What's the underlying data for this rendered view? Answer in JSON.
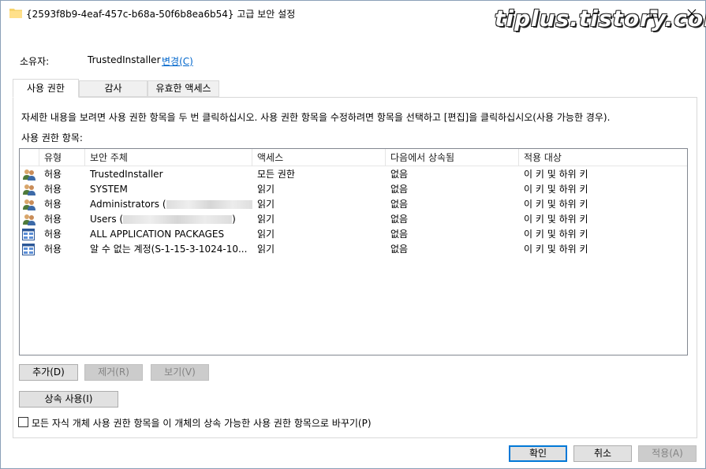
{
  "window": {
    "title": "{2593f8b9-4eaf-457c-b68a-50f6b8ea6b54} 고급 보안 설정",
    "watermark": "tiplus.tistory.com"
  },
  "owner": {
    "label": "소유자:",
    "value": "TrustedInstaller",
    "change_link": "변경(C)"
  },
  "tabs": [
    {
      "label": "사용 권한",
      "active": true
    },
    {
      "label": "감사",
      "active": false
    },
    {
      "label": "유효한 액세스",
      "active": false
    }
  ],
  "panel": {
    "description": "자세한 내용을 보려면 사용 권한 항목을 두 번 클릭하십시오. 사용 권한 항목을 수정하려면 항목을 선택하고 [편집]을 클릭하십시오(사용 가능한 경우).",
    "entries_label": "사용 권한 항목:"
  },
  "columns": {
    "type": "유형",
    "principal": "보안 주체",
    "access": "액세스",
    "inherited_from": "다음에서 상속됨",
    "applies_to": "적용 대상"
  },
  "rows": [
    {
      "icon": "users-icon",
      "type": "허용",
      "principal": "TrustedInstaller",
      "access": "모든 권한",
      "inherited_from": "없음",
      "applies_to": "이 키 및 하위 키"
    },
    {
      "icon": "users-icon",
      "type": "허용",
      "principal": "SYSTEM",
      "access": "읽기",
      "inherited_from": "없음",
      "applies_to": "이 키 및 하위 키"
    },
    {
      "icon": "users-icon",
      "type": "허용",
      "principal": "Administrators (",
      "access": "읽기",
      "inherited_from": "없음",
      "applies_to": "이 키 및 하위 키"
    },
    {
      "icon": "users-icon",
      "type": "허용",
      "principal": "Users (",
      "principal_suffix": ")",
      "access": "읽기",
      "inherited_from": "없음",
      "applies_to": "이 키 및 하위 키"
    },
    {
      "icon": "app-package-icon",
      "type": "허용",
      "principal": "ALL APPLICATION PACKAGES",
      "access": "읽기",
      "inherited_from": "없음",
      "applies_to": "이 키 및 하위 키"
    },
    {
      "icon": "app-package-icon",
      "type": "허용",
      "principal": "알 수 없는 계정(S-1-15-3-1024-10...",
      "access": "읽기",
      "inherited_from": "없음",
      "applies_to": "이 키 및 하위 키"
    }
  ],
  "buttons": {
    "add": "추가(D)",
    "remove": "제거(R)",
    "view": "보기(V)",
    "enable_inheritance": "상속 사용(I)",
    "ok": "확인",
    "cancel": "취소",
    "apply": "적용(A)"
  },
  "checkbox": {
    "label": "모든 자식 개체 사용 권한 항목을 이 개체의 상속 가능한 사용 권한 항목으로 바꾸기(P)",
    "checked": false
  }
}
